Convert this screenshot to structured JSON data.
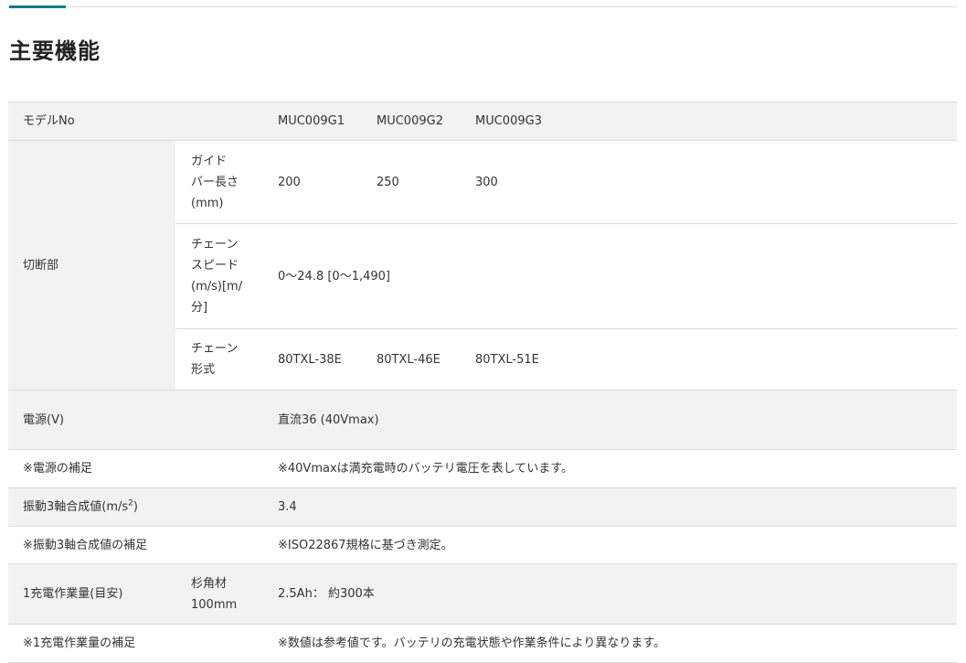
{
  "page": {
    "title": "主要機能"
  },
  "colors": {
    "accent": "#0a7c8c",
    "row_shade": "#f2f2f2",
    "divider": "#dddddd"
  },
  "table": {
    "model": {
      "label": "モデルNo",
      "values": [
        "MUC009G1",
        "MUC009G2",
        "MUC009G3"
      ]
    },
    "cutting": {
      "label": "切断部",
      "guide_bar": {
        "label": "ガイド\nバー長さ\n(mm)",
        "values": [
          "200",
          "250",
          "300"
        ]
      },
      "chain_speed": {
        "label": "チェーン\nスピード\n(m/s)[m/\n分]",
        "value": "0～24.8\n[0～1,490]"
      },
      "chain_type": {
        "label": "チェーン\n形式",
        "values": [
          "80TXL-38E",
          "80TXL-46E",
          "80TXL-51E"
        ]
      }
    },
    "power": {
      "label": "電源(V)",
      "value": "直流36\n(40Vmax)"
    },
    "power_note": {
      "label": "※電源の補足",
      "value": "※40Vmaxは満充電時のバッテリ電圧を表しています。"
    },
    "vibration": {
      "label_pre": "振動3軸合成値(m/s",
      "label_sup": "2",
      "label_post": ")",
      "value": "3.4"
    },
    "vibration_note": {
      "label": "※振動3軸合成値の補足",
      "value": "※ISO22867規格に基づき測定。"
    },
    "work": {
      "label": "1充電作業量(目安)",
      "sub_label": "杉角材\n100mm",
      "value": "2.5Ah：\n約300本"
    },
    "work_note": {
      "label": "※1充電作業量の補足",
      "value": "※数値は参考値です。バッテリの充電状態や作業条件により異なります。"
    }
  }
}
